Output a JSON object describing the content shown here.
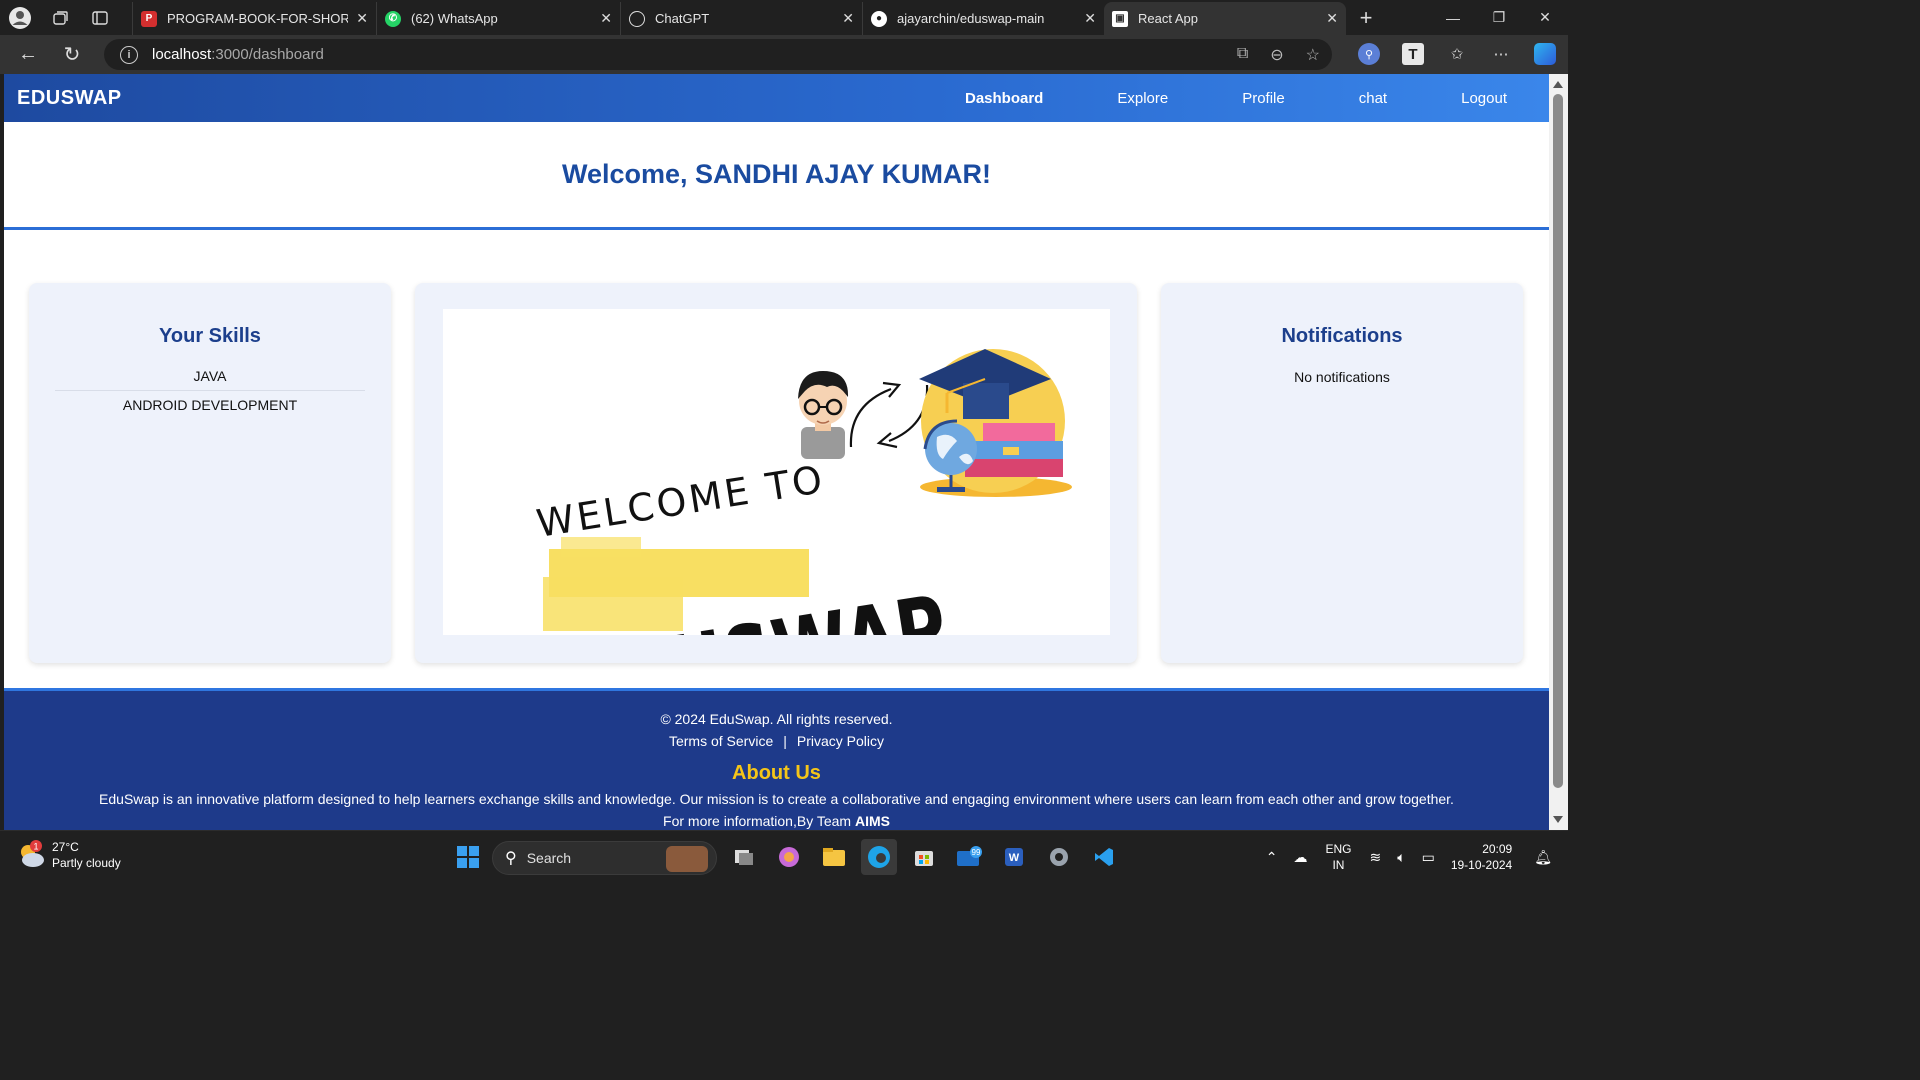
{
  "browser": {
    "tabs": [
      {
        "title": "PROGRAM-BOOK-FOR-SHORT-TE",
        "icon": "pdf-icon",
        "active": false
      },
      {
        "title": "(62) WhatsApp",
        "icon": "whatsapp-icon",
        "active": false
      },
      {
        "title": "ChatGPT",
        "icon": "chatgpt-icon",
        "active": false
      },
      {
        "title": "ajayarchin/eduswap-main",
        "icon": "github-icon",
        "active": false
      },
      {
        "title": "React App",
        "icon": "react-app-icon",
        "active": true
      }
    ],
    "url_host": "localhost",
    "url_path": ":3000/dashboard"
  },
  "navbar": {
    "brand": "EDUSWAP",
    "links": [
      "Dashboard",
      "Explore",
      "Profile",
      "chat",
      "Logout"
    ]
  },
  "welcome": "Welcome, SANDHI AJAY KUMAR!",
  "skills_card": {
    "title": "Your Skills",
    "items": [
      "JAVA",
      "ANDROID DEVELOPMENT"
    ]
  },
  "hero": {
    "line1": "WELCOME TO",
    "line2": "EDUSWAP"
  },
  "notifications_card": {
    "title": "Notifications",
    "empty_text": "No notifications"
  },
  "footer": {
    "copyright": "© 2024 EduSwap. All rights reserved.",
    "terms": "Terms of Service",
    "separator": "|",
    "privacy": "Privacy Policy",
    "about_title": "About Us",
    "about_text": "EduSwap is an innovative platform designed to help learners exchange skills and knowledge. Our mission is to create a collaborative and engaging environment where users can learn from each other and grow together.",
    "more_prefix": "For more information,By Team ",
    "more_team": "AIMS"
  },
  "taskbar": {
    "weather_temp": "27°C",
    "weather_desc": "Partly cloudy",
    "weather_badge": "1",
    "search_placeholder": "Search",
    "mail_badge": "99",
    "lang_line1": "ENG",
    "lang_line2": "IN",
    "time": "20:09",
    "date": "19-10-2024"
  },
  "colors": {
    "navbar_start": "#1e4aa0",
    "navbar_end": "#3a86ea",
    "heading_blue": "#1a4ba0",
    "footer_bg": "#1e3a8a",
    "about_title": "#f5c518",
    "card_bg": "#eef2fb"
  }
}
